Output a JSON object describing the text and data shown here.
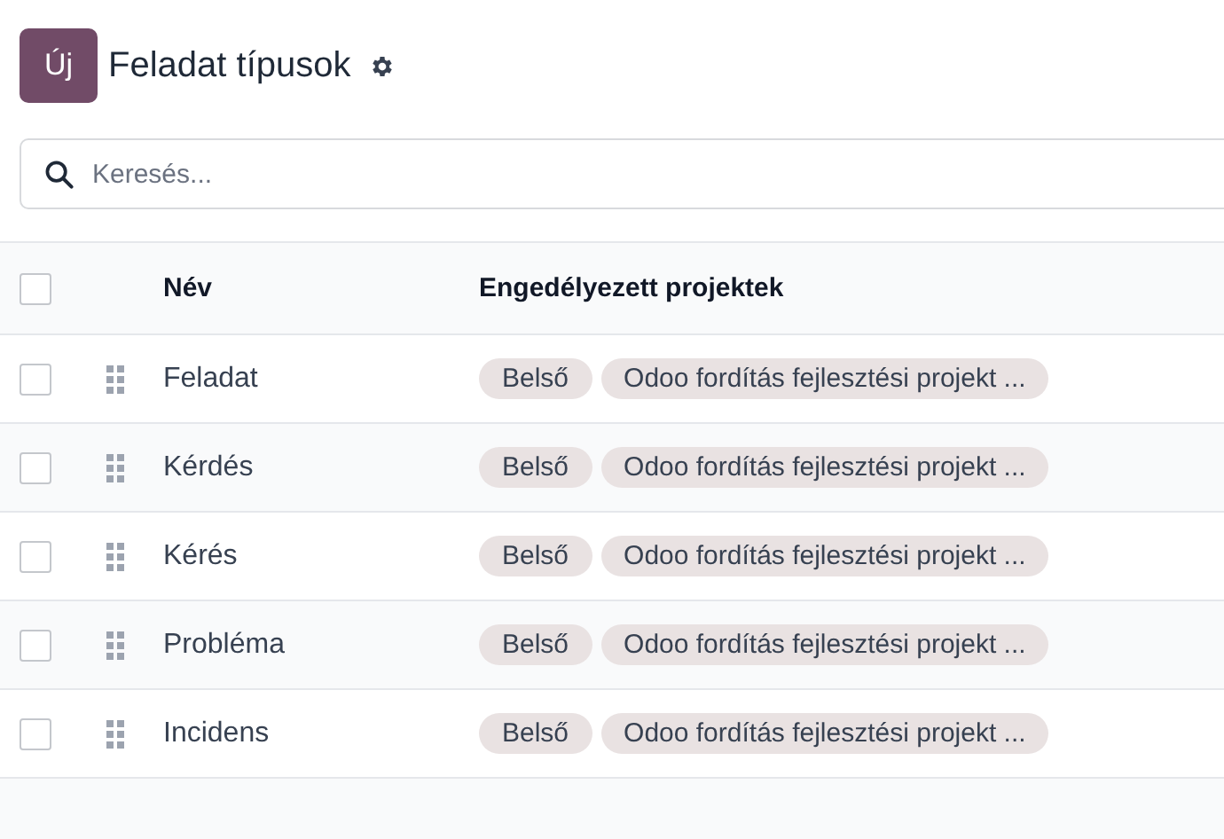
{
  "header": {
    "new_button": "Új",
    "title": "Feladat típusok"
  },
  "search": {
    "placeholder": "Keresés..."
  },
  "table": {
    "select_all": {
      "checked": false
    },
    "columns": [
      "Név",
      "Engedélyezett projektek"
    ],
    "rows": [
      {
        "checked": false,
        "name": "Feladat",
        "tags": [
          "Belső",
          "Odoo fordítás fejlesztési projekt ..."
        ]
      },
      {
        "checked": false,
        "name": "Kérdés",
        "tags": [
          "Belső",
          "Odoo fordítás fejlesztési projekt ..."
        ]
      },
      {
        "checked": false,
        "name": "Kérés",
        "tags": [
          "Belső",
          "Odoo fordítás fejlesztési projekt ..."
        ]
      },
      {
        "checked": false,
        "name": "Probléma",
        "tags": [
          "Belső",
          "Odoo fordítás fejlesztési projekt ..."
        ]
      },
      {
        "checked": false,
        "name": "Incidens",
        "tags": [
          "Belső",
          "Odoo fordítás fejlesztési projekt ..."
        ]
      }
    ]
  }
}
